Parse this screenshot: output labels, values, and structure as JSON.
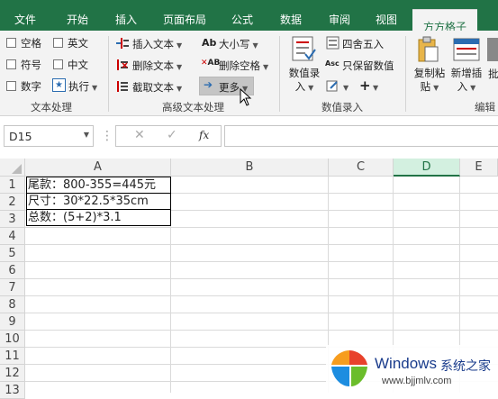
{
  "tabs": [
    "文件",
    "开始",
    "插入",
    "页面布局",
    "公式",
    "数据",
    "审阅",
    "视图",
    "方方格子"
  ],
  "active_tab": "方方格子",
  "ribbon": {
    "text_processing": {
      "checkboxes": [
        "空格",
        "英文",
        "符号",
        "中文",
        "数字"
      ],
      "execute": "执行",
      "group_label": "文本处理"
    },
    "advanced_text": {
      "insert_text": "插入文本",
      "delete_text": "删除文本",
      "extract_text": "截取文本",
      "case": "大小写",
      "delete_space": "删除空格",
      "more": "更多",
      "group_label": "高级文本处理"
    },
    "number_entry": {
      "number_entry_btn": "数值录入",
      "round": "四舍五入",
      "keep_numbers": "只保留数值",
      "group_label": "数值录入"
    },
    "edit": {
      "copy_paste": "复制粘贴",
      "new_insert": "新增插入",
      "batch": "批",
      "group_label": "编辑"
    }
  },
  "formula_bar": {
    "name_box": "D15",
    "fx": "fx",
    "formula": ""
  },
  "sheet": {
    "columns": [
      "A",
      "B",
      "C",
      "D",
      "E"
    ],
    "selected_column": "D",
    "rows": [
      "1",
      "2",
      "3",
      "4",
      "5",
      "6",
      "7",
      "8",
      "9",
      "10",
      "11",
      "12",
      "13"
    ],
    "cells": [
      {
        "ref": "A1",
        "value": "尾款：800-355=445元"
      },
      {
        "ref": "A2",
        "value": "尺寸：30*22.5*35cm"
      },
      {
        "ref": "A3",
        "value": "总数：(5+2)*3.1"
      }
    ]
  },
  "watermark": {
    "brand": "Windows",
    "brand_cn": "系统之家",
    "url": "www.bjjmlv.com"
  },
  "colors": {
    "excel_green": "#217346",
    "ribbon_bg": "#f3f3f3"
  }
}
